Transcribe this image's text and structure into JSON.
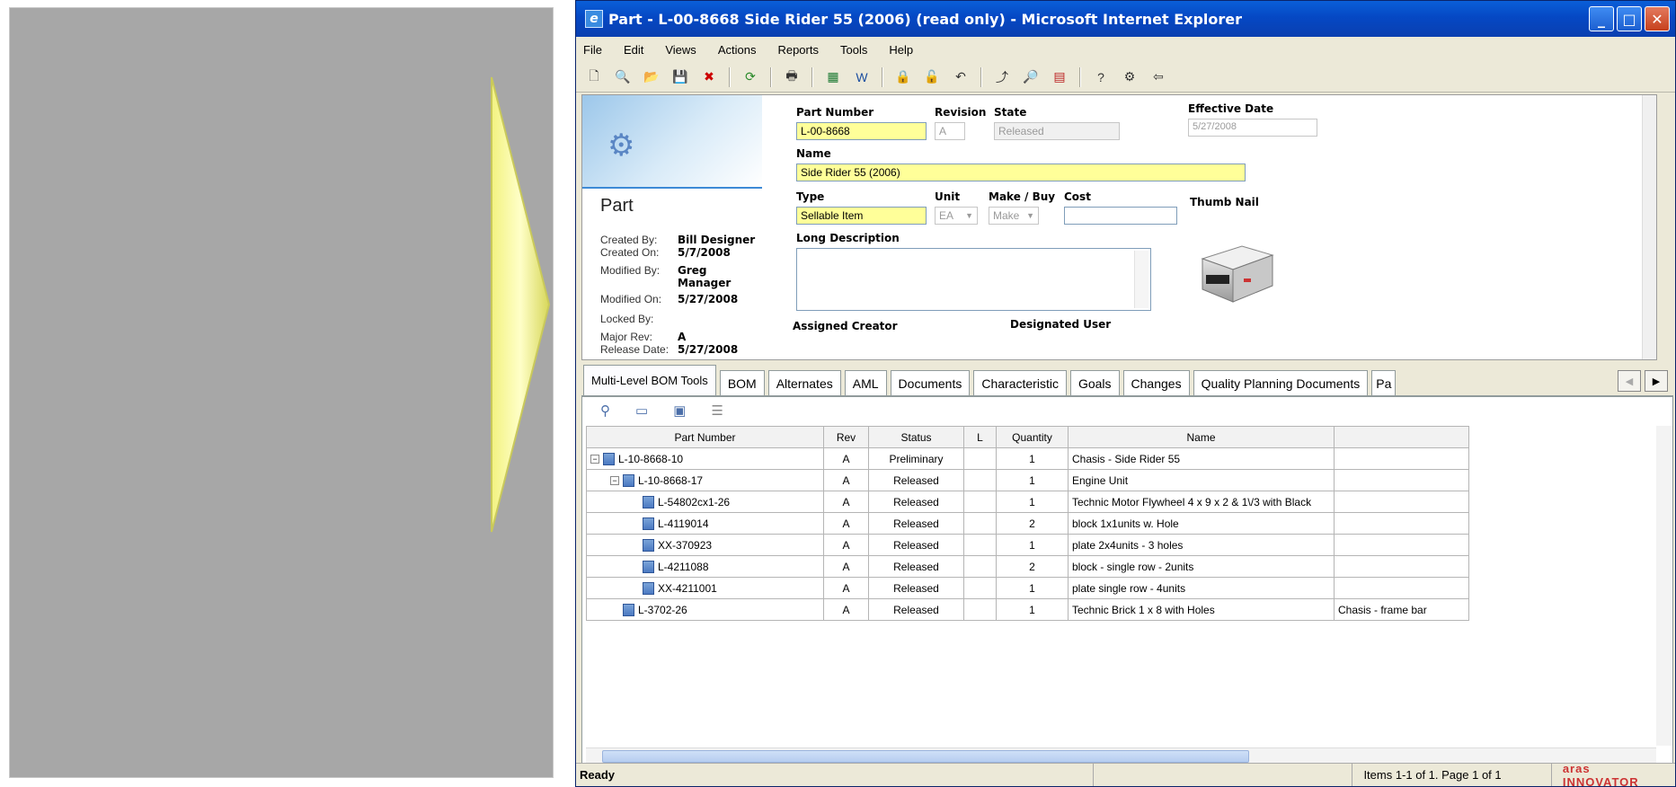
{
  "window": {
    "title": "Part - L-00-8668 Side Rider 55 (2006) (read only) - Microsoft Internet Explorer"
  },
  "menu": [
    "File",
    "Edit",
    "Views",
    "Actions",
    "Reports",
    "Tools",
    "Help"
  ],
  "toolbar_icons": [
    "new-icon",
    "view-icon",
    "open-icon",
    "save-icon",
    "delete-icon",
    "refresh-icon",
    "print-icon",
    "excel-icon",
    "word-icon",
    "lock-icon",
    "unlock-icon",
    "undo-icon",
    "promote-icon",
    "where-used-icon",
    "structure-icon",
    "help-icon",
    "properties-icon",
    "close-window-icon"
  ],
  "form": {
    "item_type": "Part",
    "meta": {
      "created_by_label": "Created By:",
      "created_by": "Bill Designer",
      "created_on_label": "Created On:",
      "created_on": "5/7/2008",
      "modified_by_label": "Modified By:",
      "modified_by": "Greg Manager",
      "modified_on_label": "Modified On:",
      "modified_on": "5/27/2008",
      "locked_by_label": "Locked By:",
      "locked_by": "",
      "major_rev_label": "Major Rev:",
      "major_rev": "A",
      "release_date_label": "Release Date:",
      "release_date": "5/27/2008"
    },
    "labels": {
      "part_number": "Part Number",
      "revision": "Revision",
      "state": "State",
      "effective_date": "Effective Date",
      "name": "Name",
      "type": "Type",
      "unit": "Unit",
      "make_buy": "Make / Buy",
      "cost": "Cost",
      "thumbnail": "Thumb Nail",
      "long_description": "Long Description",
      "assigned_creator": "Assigned Creator",
      "designated_user": "Designated User"
    },
    "values": {
      "part_number": "L-00-8668",
      "revision": "A",
      "state": "Released",
      "effective_date": "5/27/2008",
      "name": "Side Rider 55 (2006)",
      "type": "Sellable Item",
      "unit": "EA",
      "make_buy": "Make",
      "cost": "",
      "long_description": ""
    }
  },
  "tabs": [
    "Multi-Level BOM Tools",
    "BOM",
    "Alternates",
    "AML",
    "Documents",
    "Characteristic",
    "Goals",
    "Changes",
    "Quality Planning Documents",
    "Pa"
  ],
  "grid": {
    "columns": [
      "Part Number",
      "Rev",
      "Status",
      "L",
      "Quantity",
      "Name",
      ""
    ],
    "rows": [
      {
        "part": "L-10-8668-10",
        "level": 0,
        "expander": "−",
        "rev": "A",
        "status": "Preliminary",
        "l": "",
        "qty": "1",
        "name": "Chasis - Side Rider 55",
        "extra": ""
      },
      {
        "part": "L-10-8668-17",
        "level": 1,
        "expander": "−",
        "rev": "A",
        "status": "Released",
        "l": "",
        "qty": "1",
        "name": "Engine Unit",
        "extra": ""
      },
      {
        "part": "L-54802cx1-26",
        "level": 2,
        "expander": "",
        "rev": "A",
        "status": "Released",
        "l": "",
        "qty": "1",
        "name": "Technic Motor Flywheel 4 x 9 x 2 & 1\\/3 with Black",
        "extra": ""
      },
      {
        "part": "L-4119014",
        "level": 2,
        "expander": "",
        "rev": "A",
        "status": "Released",
        "l": "",
        "qty": "2",
        "name": "block 1x1units w. Hole",
        "extra": ""
      },
      {
        "part": "XX-370923",
        "level": 2,
        "expander": "",
        "rev": "A",
        "status": "Released",
        "l": "",
        "qty": "1",
        "name": "plate 2x4units - 3 holes",
        "extra": ""
      },
      {
        "part": "L-4211088",
        "level": 2,
        "expander": "",
        "rev": "A",
        "status": "Released",
        "l": "",
        "qty": "2",
        "name": "block - single row - 2units",
        "extra": ""
      },
      {
        "part": "XX-4211001",
        "level": 2,
        "expander": "",
        "rev": "A",
        "status": "Released",
        "l": "",
        "qty": "1",
        "name": "plate single row - 4units",
        "extra": ""
      },
      {
        "part": "L-3702-26",
        "level": 1,
        "expander": "",
        "rev": "A",
        "status": "Released",
        "l": "",
        "qty": "1",
        "name": "Technic Brick 1 x 8 with Holes",
        "extra": "Chasis - frame bar"
      }
    ]
  },
  "status": {
    "ready": "Ready",
    "items": "Items 1-1 of 1. Page 1 of 1",
    "logo": "aras INNOVATOR"
  }
}
